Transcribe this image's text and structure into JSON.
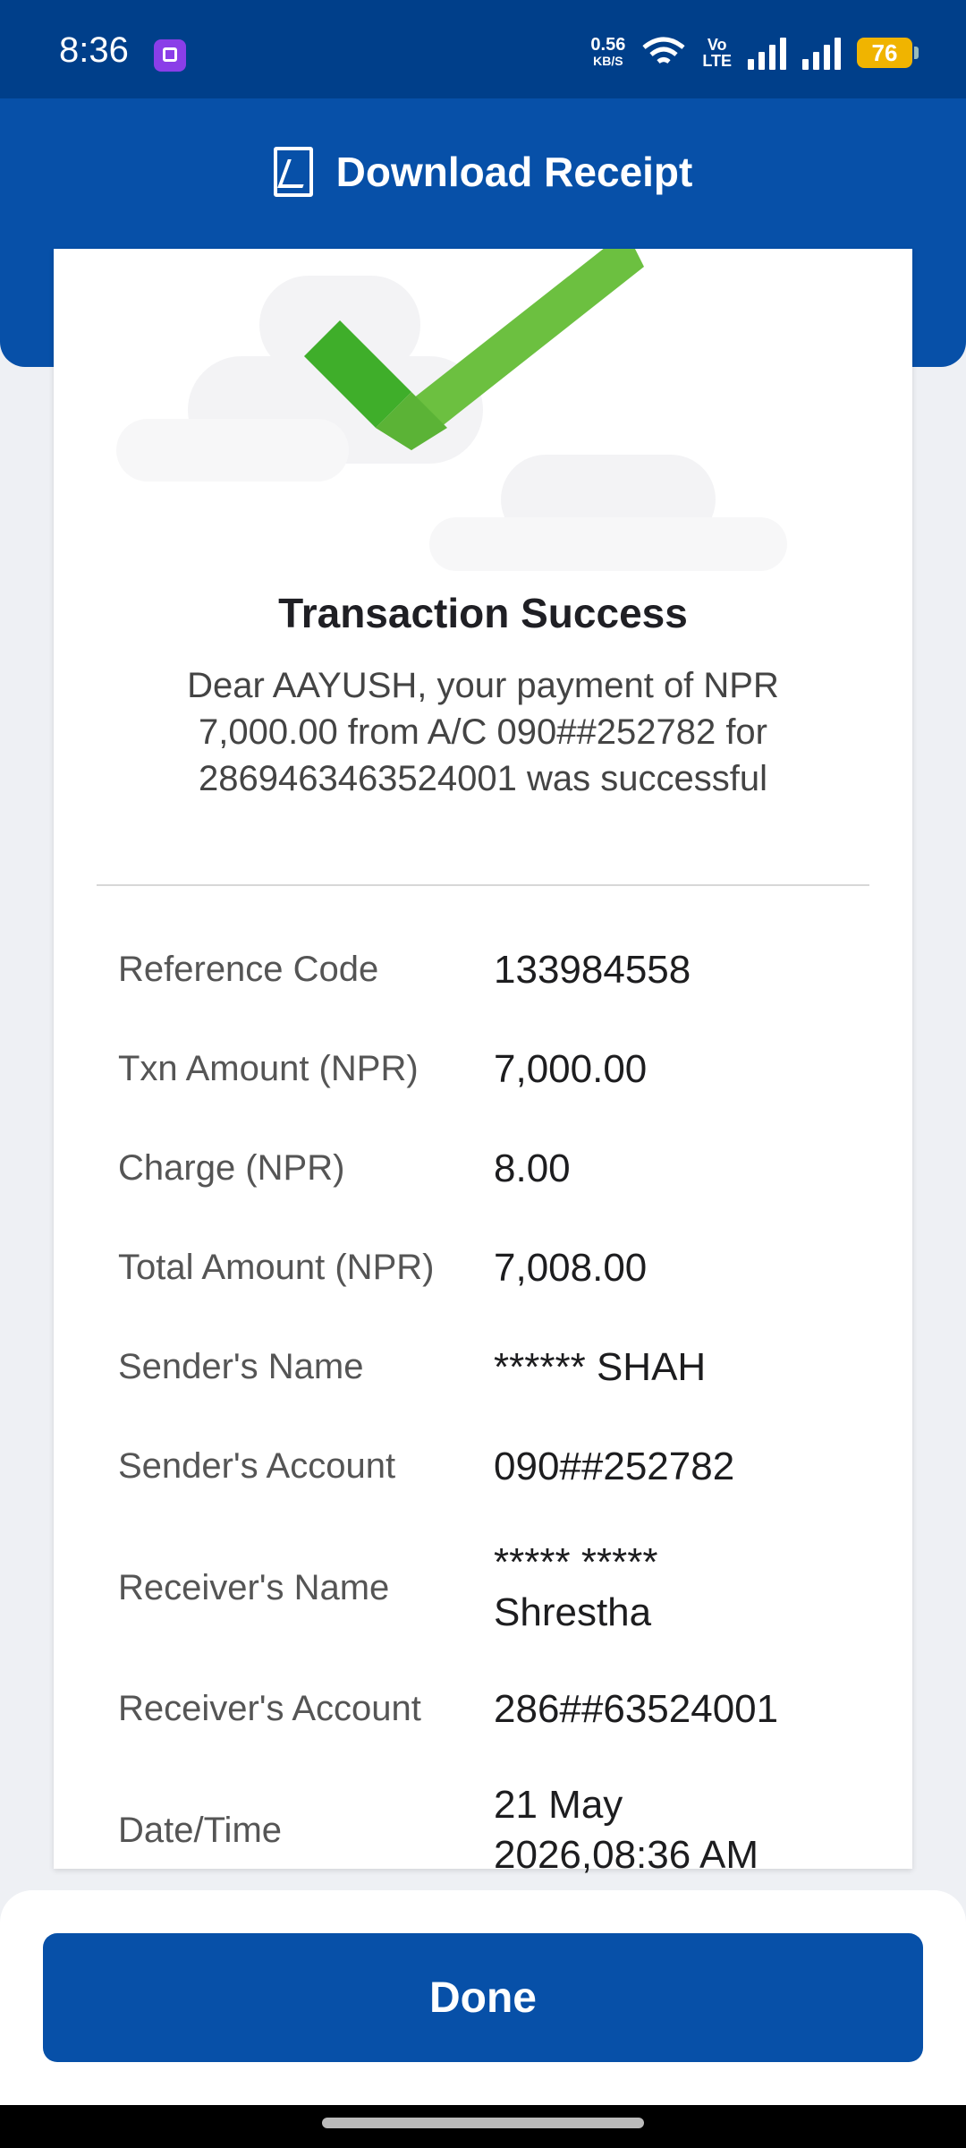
{
  "status_bar": {
    "time": "8:36",
    "speed_value": "0.56",
    "speed_unit": "KB/S",
    "volte_top": "Vo",
    "volte_bottom": "LTE",
    "battery": "76"
  },
  "header": {
    "title": "Download Receipt"
  },
  "transaction": {
    "title": "Transaction Success",
    "message": "Dear AAYUSH, your payment of NPR 7,000.00 from A/C 090##252782 for 2869463463524001 was successful"
  },
  "details": [
    {
      "label": "Reference Code",
      "value": "133984558"
    },
    {
      "label": "Txn Amount (NPR)",
      "value": "7,000.00"
    },
    {
      "label": "Charge (NPR)",
      "value": "8.00"
    },
    {
      "label": "Total Amount (NPR)",
      "value": "7,008.00"
    },
    {
      "label": "Sender's Name",
      "value": "****** SHAH"
    },
    {
      "label": "Sender's Account",
      "value": "090##252782"
    },
    {
      "label": "Receiver's Name",
      "value": "***** ***** Shrestha"
    },
    {
      "label": "Receiver's Account",
      "value": "286##63524001"
    },
    {
      "label": "Date/Time",
      "value": "21 May 2026,08:36 AM"
    }
  ],
  "actions": {
    "done_label": "Done"
  },
  "colors": {
    "primary": "#0750a8",
    "status_bar": "#003f8a",
    "success": "#6cc040"
  }
}
